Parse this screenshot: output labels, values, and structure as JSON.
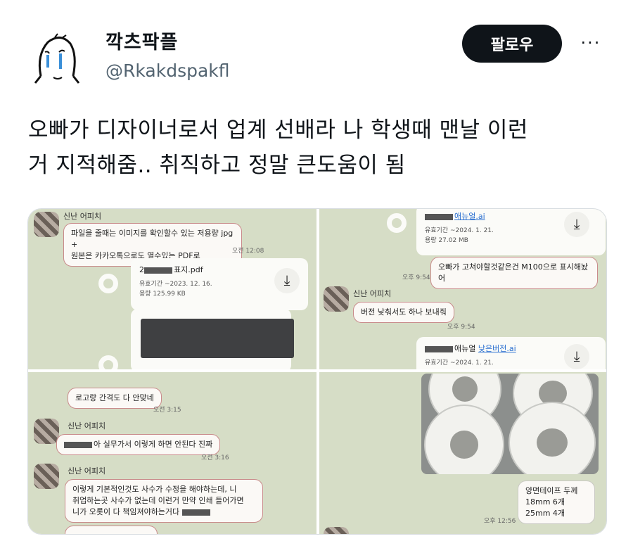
{
  "profile": {
    "display_name": "깍츠팍플",
    "handle": "@Rkakdspakfl",
    "follow_label": "팔로우",
    "more_label": "···"
  },
  "tweet": {
    "text_line1": "오빠가 디자이너로서 업계 선배라 나 학생때 맨날 이런",
    "text_line2": "거 지적해줌.. 취직하고 정말 큰도움이 됨"
  },
  "media": {
    "p1": {
      "sender": "신난 어피치",
      "bubble_line1": "파일을 줄때는 이미지를 확인할수 있는 저용량 jpg +",
      "bubble_line2": "원본은 카카오톡으로도 열수있는 PDF로",
      "time1": "오전 12:08",
      "file_name": "2█████표지.pdf",
      "file_name_suffix": "표지.pdf",
      "file_meta1": "유효기간 ~2023. 12. 16.",
      "file_meta2": "용량 125.99 KB"
    },
    "p2": {
      "file1_name": "애뉴얼.ai",
      "file1_meta1": "유효기간 ~2024. 1. 21.",
      "file1_meta2": "용량 27.02 MB",
      "bubble_mine": "오빠가 고쳐야할것같은건 M100으로 표시해놨어",
      "time1": "오후 9:54",
      "sender": "신난 어피치",
      "bubble_theirs": "버전 낮춰서도 하나 보내줘",
      "time2": "오후 9:54",
      "file2_name_a": "애뉴얼",
      "file2_name_b": "낮은버전.ai",
      "file2_meta1": "유효기간 ~2024. 1. 21."
    },
    "p3": {
      "bubble1": "로고랑 간격도 다 안맞네",
      "time1": "오전 3:15",
      "sender1": "신난 어피치",
      "bubble2": "아 실무가서 이렇게 하면 안된다 진짜",
      "time2": "오전 3:16",
      "sender2": "신난 어피치",
      "bubble3_line1": "이렇게 기본적인것도 사수가 수정을 해야하는데, 니",
      "bubble3_line2": "취업하는곳 사수가 없는데 이런거 만약 인쇄 들어가면",
      "bubble3_line3": "니가 오롯이 다 책임져야하는거다"
    },
    "p4": {
      "bubble_line1": "양면테이프 두께",
      "bubble_line2": "18mm 6개",
      "bubble_line3": "25mm 4개",
      "time1": "오후 12:56"
    }
  },
  "icons": {
    "download": "download-icon",
    "avatar": "crying-face-avatar"
  }
}
